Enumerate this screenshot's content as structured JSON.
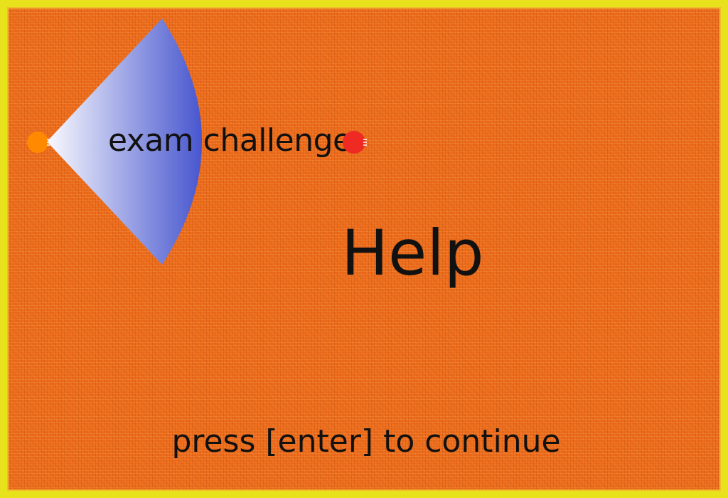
{
  "game": {
    "title": "exam challenge",
    "screen_heading": "Help",
    "prompt": "press [enter] to continue"
  },
  "sprites": {
    "player": {
      "icon": "player-dot-icon",
      "color": "#ff8a00"
    },
    "enemy": {
      "icon": "enemy-dot-icon",
      "color": "#ef2a22"
    },
    "vision_cone": {
      "icon": "vision-cone-icon",
      "color_start": "#ffffff",
      "color_end": "#3a4acb"
    }
  },
  "colors": {
    "border": "#e7e21c",
    "background": "#ec6a1a",
    "text": "#111111"
  }
}
